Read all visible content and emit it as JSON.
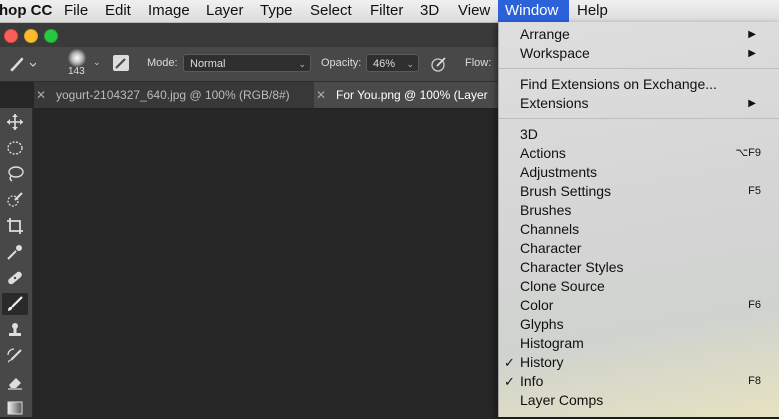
{
  "menubar": {
    "items": [
      {
        "label": "hop CC"
      },
      {
        "label": "File"
      },
      {
        "label": "Edit"
      },
      {
        "label": "Image"
      },
      {
        "label": "Layer"
      },
      {
        "label": "Type"
      },
      {
        "label": "Select"
      },
      {
        "label": "Filter"
      },
      {
        "label": "3D"
      },
      {
        "label": "View"
      },
      {
        "label": "Window"
      },
      {
        "label": "Help"
      }
    ],
    "active": "Window"
  },
  "options": {
    "brush_size": "143",
    "mode_label": "Mode:",
    "mode_value": "Normal",
    "opacity_label": "Opacity:",
    "opacity_value": "46%",
    "flow_label": "Flow:"
  },
  "tabs": [
    {
      "label": "yogurt-2104327_640.jpg @ 100% (RGB/8#)"
    },
    {
      "label": "For You.png @ 100% (Layer"
    }
  ],
  "tools": [
    "move-icon",
    "marquee-icon",
    "lasso-icon",
    "quick-select-icon",
    "crop-icon",
    "eyedropper-icon",
    "healing-icon",
    "brush-icon",
    "stamp-icon",
    "history-brush-icon",
    "eraser-icon",
    "gradient-icon"
  ],
  "window_menu": {
    "items": [
      {
        "label": "Arrange",
        "submenu": true
      },
      {
        "label": "Workspace",
        "submenu": true
      },
      {
        "label": "Find Extensions on Exchange..."
      },
      {
        "label": "Extensions",
        "submenu": true
      },
      {
        "label": "3D"
      },
      {
        "label": "Actions",
        "shortcut": "⌥F9"
      },
      {
        "label": "Adjustments"
      },
      {
        "label": "Brush Settings",
        "shortcut": "F5"
      },
      {
        "label": "Brushes"
      },
      {
        "label": "Channels"
      },
      {
        "label": "Character"
      },
      {
        "label": "Character Styles"
      },
      {
        "label": "Clone Source"
      },
      {
        "label": "Color",
        "shortcut": "F6"
      },
      {
        "label": "Glyphs"
      },
      {
        "label": "Histogram"
      },
      {
        "label": "History",
        "checked": true
      },
      {
        "label": "Info",
        "checked": true,
        "shortcut": "F8"
      },
      {
        "label": "Layer Comps"
      }
    ],
    "submenu_arrow": "▶",
    "check_mark": "✓"
  },
  "colors": {
    "menu_highlight": "#2b62d9",
    "canvas": "#262626",
    "panel": "#484848"
  }
}
